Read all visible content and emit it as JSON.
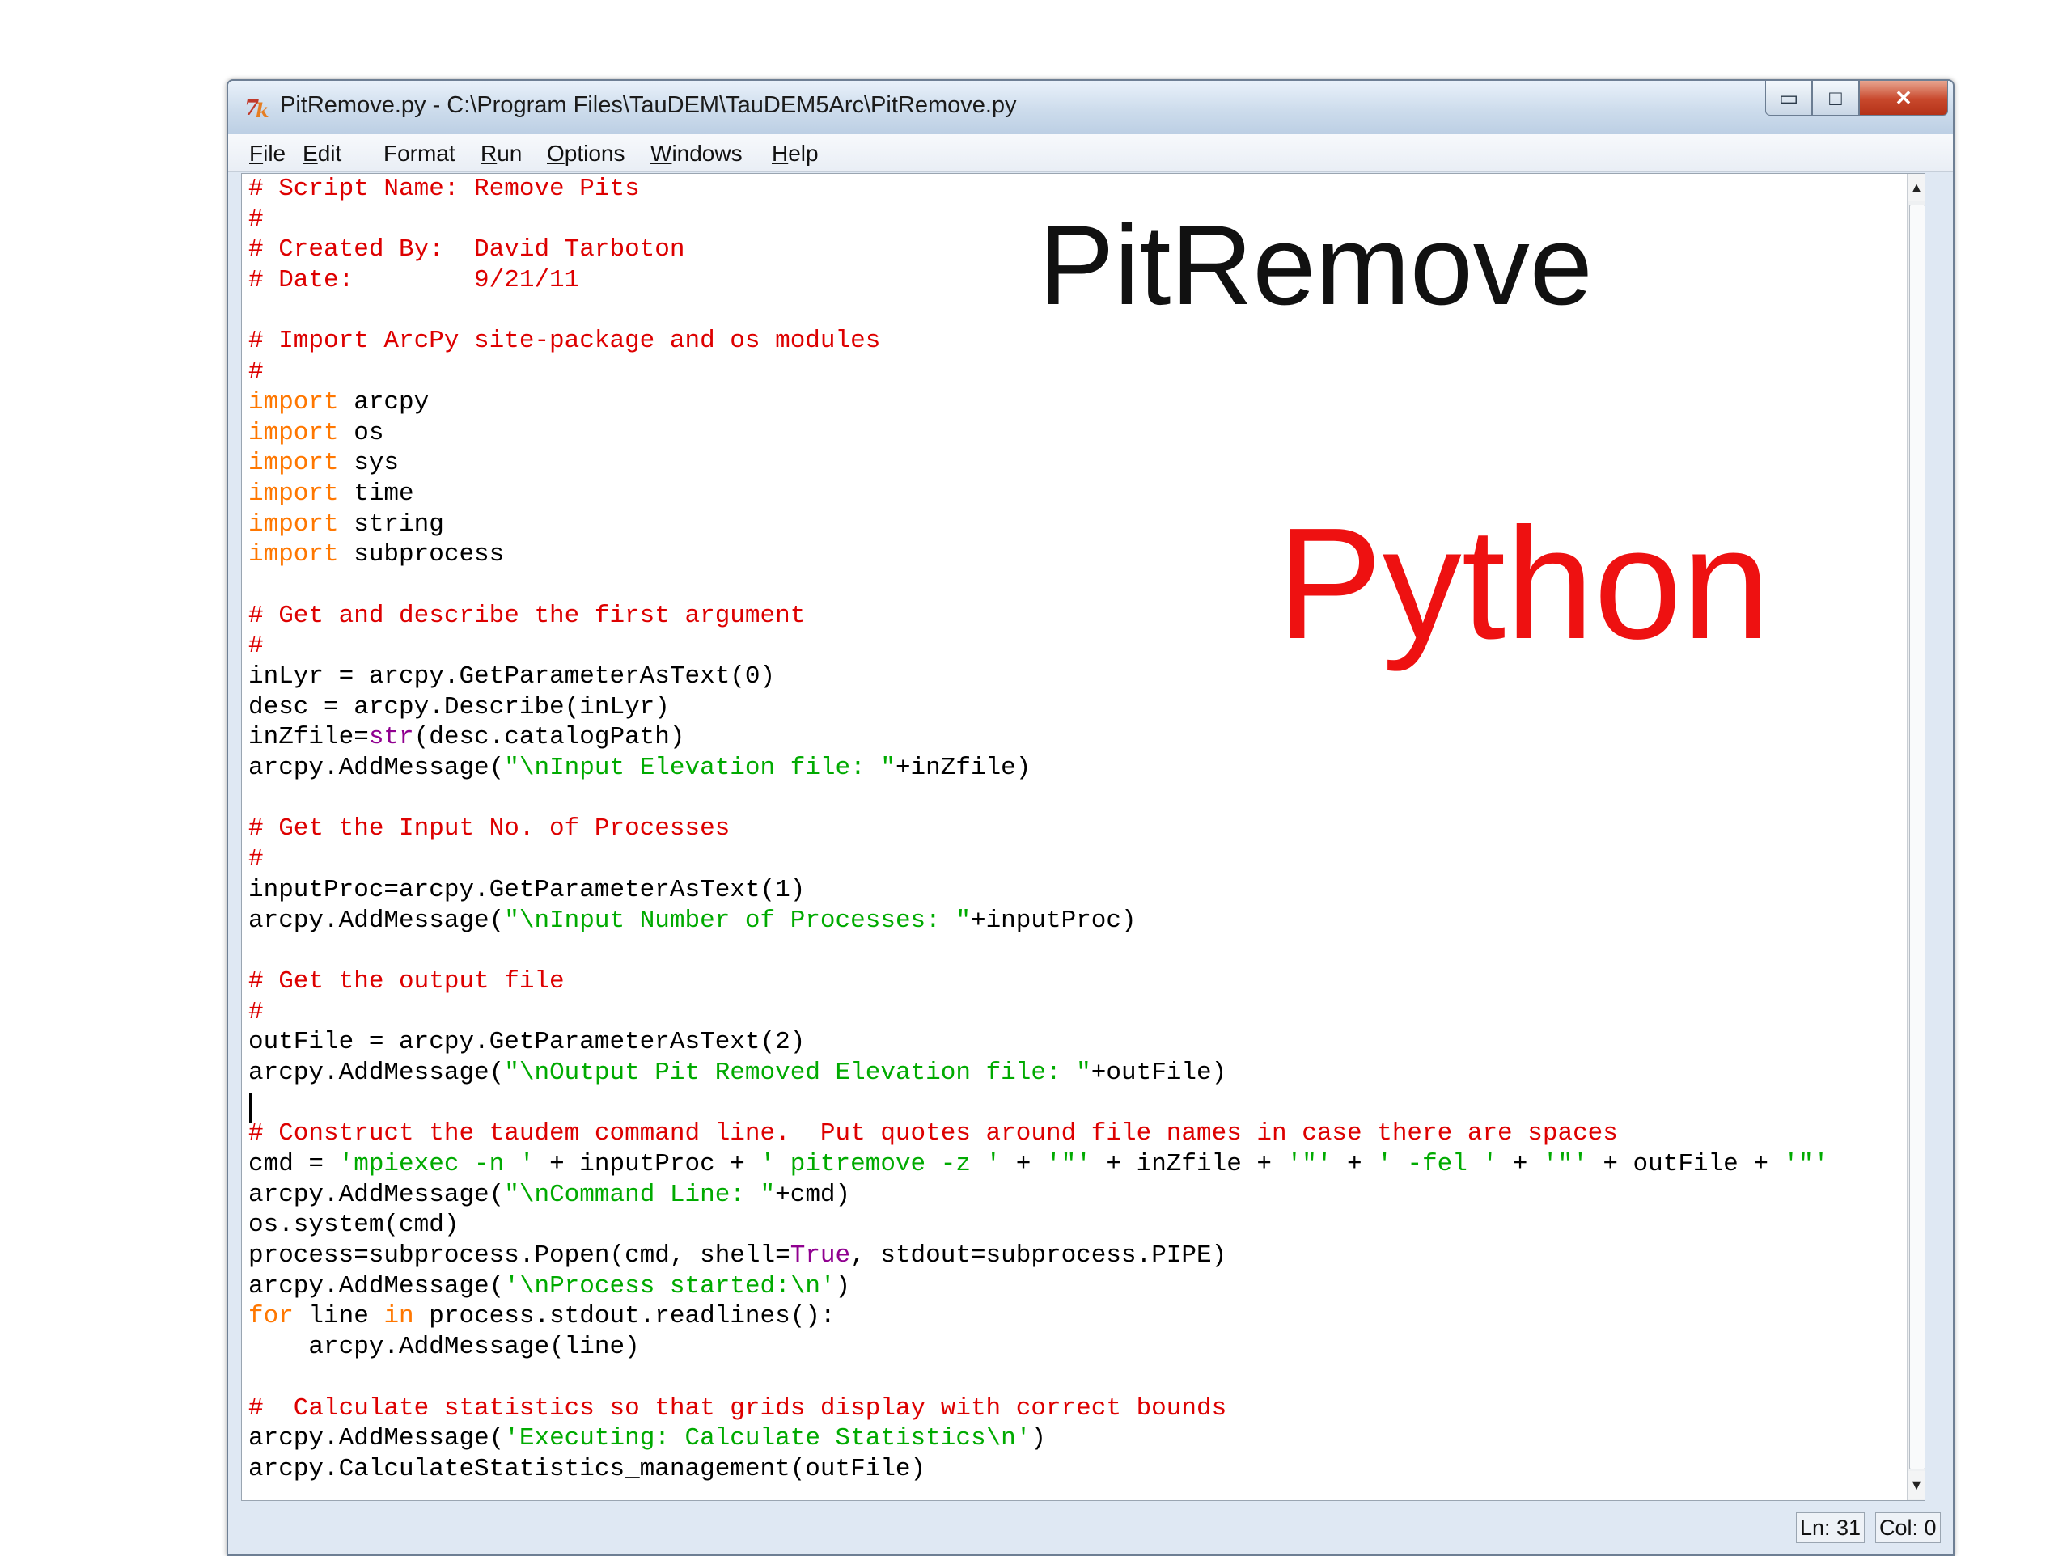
{
  "window": {
    "title": "PitRemove.py - C:\\Program Files\\TauDEM\\TauDEM5Arc\\PitRemove.py",
    "controls": {
      "minimize": "▭",
      "maximize": "□",
      "close": "✕"
    }
  },
  "menu": {
    "items": [
      {
        "first": "F",
        "rest": "ile"
      },
      {
        "first": "E",
        "rest": "dit"
      },
      {
        "first": "F",
        "rest": "ormat",
        "full": "Format"
      },
      {
        "first": "R",
        "rest": "un"
      },
      {
        "first": "O",
        "rest": "ptions"
      },
      {
        "first": "W",
        "rest": "indows"
      },
      {
        "first": "H",
        "rest": "elp"
      }
    ]
  },
  "code": {
    "lines": [
      [
        [
          "comment",
          "# Script Name: Remove Pits"
        ]
      ],
      [
        [
          "comment",
          "#"
        ]
      ],
      [
        [
          "comment",
          "# Created By:  David Tarboton"
        ]
      ],
      [
        [
          "comment",
          "# Date:        9/21/11"
        ]
      ],
      [],
      [
        [
          "comment",
          "# Import ArcPy site-package and os modules"
        ]
      ],
      [
        [
          "comment",
          "#"
        ]
      ],
      [
        [
          "kw",
          "import"
        ],
        [
          "plain",
          " arcpy"
        ]
      ],
      [
        [
          "kw",
          "import"
        ],
        [
          "plain",
          " os"
        ]
      ],
      [
        [
          "kw",
          "import"
        ],
        [
          "plain",
          " sys"
        ]
      ],
      [
        [
          "kw",
          "import"
        ],
        [
          "plain",
          " time"
        ]
      ],
      [
        [
          "kw",
          "import"
        ],
        [
          "plain",
          " string"
        ]
      ],
      [
        [
          "kw",
          "import"
        ],
        [
          "plain",
          " subprocess"
        ]
      ],
      [],
      [
        [
          "comment",
          "# Get and describe the first argument"
        ]
      ],
      [
        [
          "comment",
          "#"
        ]
      ],
      [
        [
          "plain",
          "inLyr = arcpy.GetParameterAsText(0)"
        ]
      ],
      [
        [
          "plain",
          "desc = arcpy.Describe(inLyr)"
        ]
      ],
      [
        [
          "plain",
          "inZfile="
        ],
        [
          "bi",
          "str"
        ],
        [
          "plain",
          "(desc.catalogPath)"
        ]
      ],
      [
        [
          "plain",
          "arcpy.AddMessage("
        ],
        [
          "str",
          "\"\\nInput Elevation file: \""
        ],
        [
          "plain",
          "+inZfile)"
        ]
      ],
      [],
      [
        [
          "comment",
          "# Get the Input No. of Processes"
        ]
      ],
      [
        [
          "comment",
          "#"
        ]
      ],
      [
        [
          "plain",
          "inputProc=arcpy.GetParameterAsText(1)"
        ]
      ],
      [
        [
          "plain",
          "arcpy.AddMessage("
        ],
        [
          "str",
          "\"\\nInput Number of Processes: \""
        ],
        [
          "plain",
          "+inputProc)"
        ]
      ],
      [],
      [
        [
          "comment",
          "# Get the output file"
        ]
      ],
      [
        [
          "comment",
          "#"
        ]
      ],
      [
        [
          "plain",
          "outFile = arcpy.GetParameterAsText(2)"
        ]
      ],
      [
        [
          "plain",
          "arcpy.AddMessage("
        ],
        [
          "str",
          "\"\\nOutput Pit Removed Elevation file: \""
        ],
        [
          "plain",
          "+outFile)"
        ]
      ],
      [],
      [
        [
          "comment",
          "# Construct the taudem command line.  Put quotes around file names in case there are spaces"
        ]
      ],
      [
        [
          "plain",
          "cmd = "
        ],
        [
          "str",
          "'mpiexec -n '"
        ],
        [
          "plain",
          " + inputProc + "
        ],
        [
          "str",
          "' pitremove -z '"
        ],
        [
          "plain",
          " + "
        ],
        [
          "str",
          "'\"'"
        ],
        [
          "plain",
          " + inZfile + "
        ],
        [
          "str",
          "'\"'"
        ],
        [
          "plain",
          " + "
        ],
        [
          "str",
          "' -fel '"
        ],
        [
          "plain",
          " + "
        ],
        [
          "str",
          "'\"'"
        ],
        [
          "plain",
          " + outFile + "
        ],
        [
          "str",
          "'\"'"
        ]
      ],
      [
        [
          "plain",
          "arcpy.AddMessage("
        ],
        [
          "str",
          "\"\\nCommand Line: \""
        ],
        [
          "plain",
          "+cmd)"
        ]
      ],
      [
        [
          "plain",
          "os.system(cmd)"
        ]
      ],
      [
        [
          "plain",
          "process=subprocess.Popen(cmd, shell="
        ],
        [
          "bi",
          "True"
        ],
        [
          "plain",
          ", stdout=subprocess.PIPE)"
        ]
      ],
      [
        [
          "plain",
          "arcpy.AddMessage("
        ],
        [
          "str",
          "'\\nProcess started:\\n'"
        ],
        [
          "plain",
          ")"
        ]
      ],
      [
        [
          "kw",
          "for"
        ],
        [
          "plain",
          " line "
        ],
        [
          "kw",
          "in"
        ],
        [
          "plain",
          " process.stdout.readlines():"
        ]
      ],
      [
        [
          "plain",
          "    arcpy.AddMessage(line)"
        ]
      ],
      [],
      [
        [
          "comment",
          "#  Calculate statistics so that grids display with correct bounds"
        ]
      ],
      [
        [
          "plain",
          "arcpy.AddMessage("
        ],
        [
          "str",
          "'Executing: Calculate Statistics\\n'"
        ],
        [
          "plain",
          ")"
        ]
      ],
      [
        [
          "plain",
          "arcpy.CalculateStatistics_management(outFile)"
        ]
      ]
    ]
  },
  "status": {
    "line": "Ln: 31",
    "col": "Col: 0"
  },
  "scroll": {
    "up": "▲",
    "down": "▼"
  },
  "overlay": {
    "title": "PitRemove",
    "language": "Python"
  },
  "colors": {
    "comment": "#dd0000",
    "keyword": "#ff7700",
    "string": "#00aa00",
    "builtin": "#900090",
    "overlay_language": "#ee1111"
  }
}
